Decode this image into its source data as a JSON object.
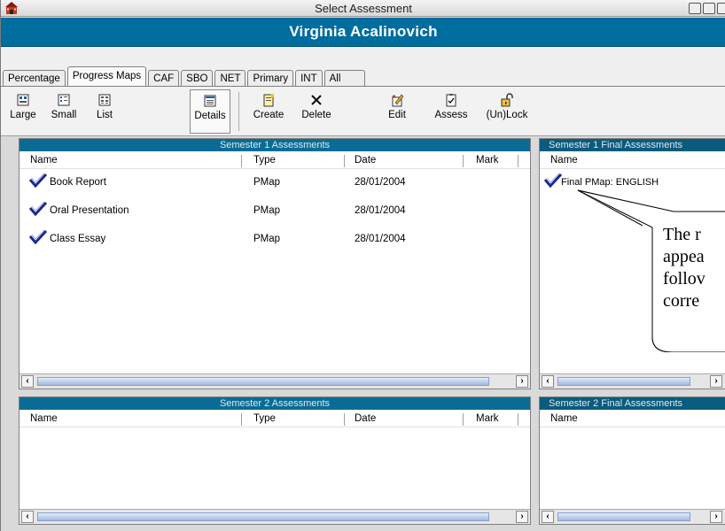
{
  "window": {
    "title": "Select Assessment"
  },
  "header": {
    "student_name": "Virginia Acalinovich"
  },
  "tabs": [
    {
      "label": "Percentage",
      "active": false
    },
    {
      "label": "Progress Maps",
      "active": true
    },
    {
      "label": "CAF",
      "active": false
    },
    {
      "label": "SBO",
      "active": false
    },
    {
      "label": "NET",
      "active": false
    },
    {
      "label": "Primary",
      "active": false
    },
    {
      "label": "INT",
      "active": false
    },
    {
      "label": "All",
      "active": false
    }
  ],
  "toolbar": {
    "large": "Large",
    "small": "Small",
    "list": "List",
    "details": "Details",
    "create": "Create",
    "delete": "Delete",
    "edit": "Edit",
    "assess": "Assess",
    "unlock": "(Un)Lock"
  },
  "sem1": {
    "title": "Semester 1 Assessments",
    "columns": {
      "name": "Name",
      "type": "Type",
      "date": "Date",
      "mark": "Mark"
    },
    "rows": [
      {
        "name": "Book Report",
        "type": "PMap",
        "date": "28/01/2004",
        "mark": ""
      },
      {
        "name": "Oral Presentation",
        "type": "PMap",
        "date": "28/01/2004",
        "mark": ""
      },
      {
        "name": "Class Essay",
        "type": "PMap",
        "date": "28/01/2004",
        "mark": ""
      }
    ]
  },
  "sem1_final": {
    "title": "Semester 1 Final Assessments",
    "columns": {
      "name": "Name"
    },
    "rows": [
      {
        "name": "Final PMap: ENGLISH"
      }
    ]
  },
  "sem2": {
    "title": "Semester 2 Assessments",
    "columns": {
      "name": "Name",
      "type": "Type",
      "date": "Date",
      "mark": "Mark"
    }
  },
  "sem2_final": {
    "title": "Semester 2 Final Assessments",
    "columns": {
      "name": "Name"
    }
  },
  "callout": {
    "line1": "The r",
    "line2": "appea",
    "line3": "follov",
    "line4": "corre"
  },
  "colors": {
    "header_blue": "#006d9f",
    "panel_title": "#0a6c95",
    "check_blue": "#1a2a8c"
  }
}
